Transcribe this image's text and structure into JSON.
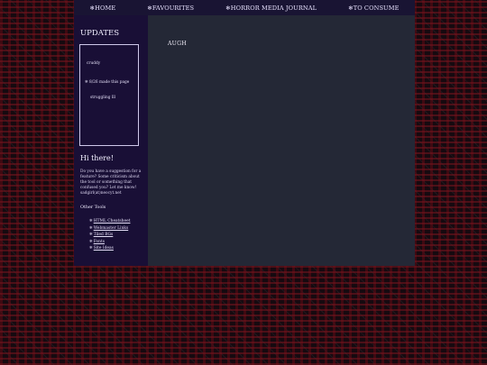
{
  "nav": {
    "items": [
      {
        "icon": "❄",
        "label": "HOME"
      },
      {
        "icon": "❄",
        "label": "FAVOURITES"
      },
      {
        "icon": "❄",
        "label": "HORROR MEDIA JOURNAL"
      },
      {
        "icon": "❄",
        "label": "TO CONSUME"
      }
    ]
  },
  "sidebar": {
    "updates_title": "UPDATES",
    "updates": [
      {
        "text": "cruddy"
      },
      {
        "icon": "❄",
        "text": "8/26 made this page"
      },
      {
        "text": "struggling lll"
      }
    ],
    "hi_title": "Hi there!",
    "hi_body": "Do you have a suggestion for a feature? Some criticism about the tool or something that confused you? Let me know! sadgirl(at)neocyt.net",
    "other_tools_title": "Other Tools",
    "tools": [
      {
        "icon": "❄",
        "label": "HTML Cheatsheet"
      },
      {
        "icon": "❄",
        "label": "Webmaster Links"
      },
      {
        "icon": "❄",
        "label": "Tiled BGs"
      },
      {
        "icon": "❄",
        "label": "Fonts"
      },
      {
        "icon": "❄",
        "label": "Site Ideas"
      }
    ]
  },
  "main": {
    "text": "AUGH"
  }
}
